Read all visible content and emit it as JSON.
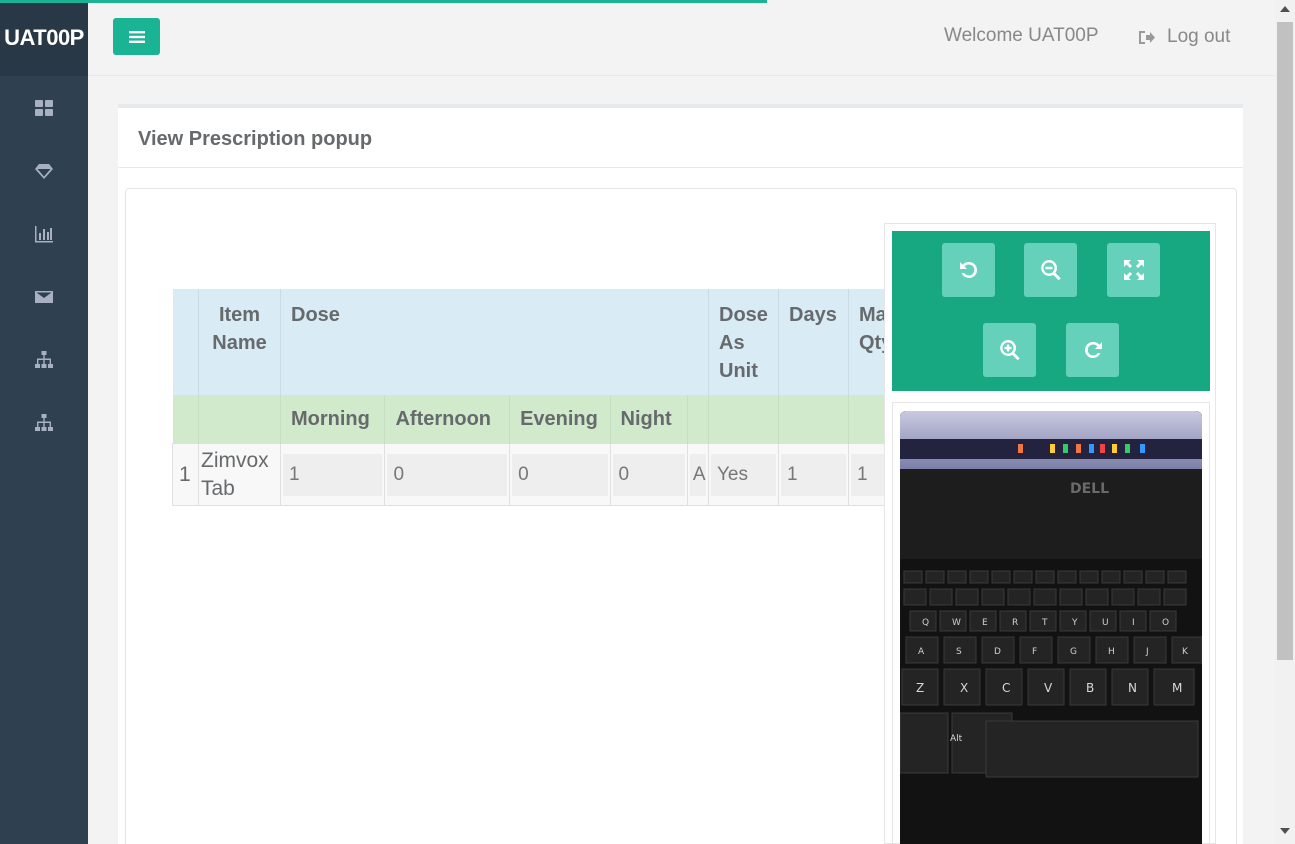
{
  "brand": "UAT00P",
  "header": {
    "welcome": "Welcome UAT00P",
    "logout": "Log out"
  },
  "sidebar": {
    "icons": [
      "dashboard-icon",
      "diamond-icon",
      "bar-chart-icon",
      "envelope-icon",
      "sitemap-icon",
      "sitemap-icon"
    ]
  },
  "panel": {
    "title": "View Prescription popup"
  },
  "table": {
    "headers": {
      "item_name": "Item Name",
      "dose": "Dose",
      "dose_as_unit": "Dose As Unit",
      "days": "Days",
      "max_qty": "Max Qty"
    },
    "sub_headers": [
      "Morning",
      "Afternoon",
      "Evening",
      "Night"
    ],
    "rows": [
      {
        "index": "1",
        "item": "Zimvox Tab",
        "morning": "1",
        "afternoon": "0",
        "evening": "0",
        "night": "0",
        "truncated": "A",
        "dose_as_unit": "Yes",
        "days": "1",
        "max_qty": "1"
      }
    ]
  },
  "viewer": {
    "buttons": [
      "rotate-left-icon",
      "zoom-out-icon",
      "fullscreen-icon",
      "zoom-in-icon",
      "rotate-right-icon"
    ]
  },
  "colors": {
    "accent": "#1ab394",
    "sidebar": "#2f4050",
    "header_blue": "#d9ebf5",
    "header_green": "#d1eacc"
  }
}
